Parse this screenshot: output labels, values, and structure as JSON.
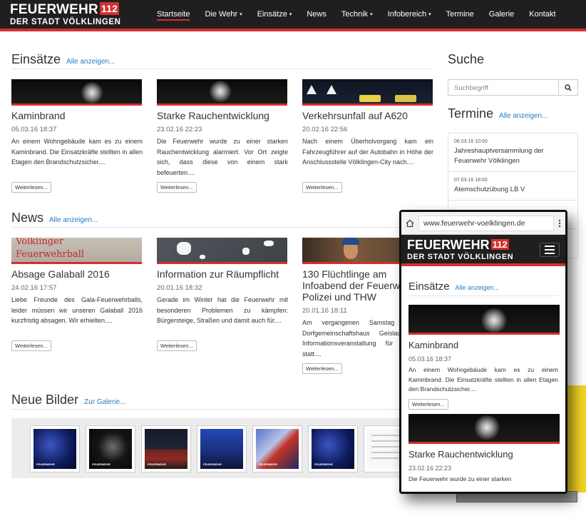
{
  "header": {
    "logo": {
      "line1": "FEUERWEHR",
      "number": "112",
      "line2": "DER STADT VÖLKLINGEN"
    },
    "nav": [
      {
        "label": "Startseite",
        "caret": ""
      },
      {
        "label": "Die Wehr",
        "caret": "▾"
      },
      {
        "label": "Einsätze",
        "caret": "▾"
      },
      {
        "label": "News",
        "caret": ""
      },
      {
        "label": "Technik",
        "caret": "▾"
      },
      {
        "label": "Infobereich",
        "caret": "▾"
      },
      {
        "label": "Termine",
        "caret": ""
      },
      {
        "label": "Galerie",
        "caret": ""
      },
      {
        "label": "Kontakt",
        "caret": ""
      }
    ],
    "active_nav": "Startseite"
  },
  "einsaetze": {
    "title": "Einsätze",
    "link": "Alle anzeigen...",
    "items": [
      {
        "title": "Kaminbrand",
        "date": "05.03.16 18:37",
        "text": "An einem Wohngebäude kam es zu einem Kaminbrand. Die Einsatzkräfte stellten in allen Etagen den Brandschutzsicher....",
        "button": "Weiterlesen..."
      },
      {
        "title": "Starke Rauchentwicklung",
        "date": "23.02.16 22:23",
        "text": "Die Feuerwehr wurde zu einer starken Rauchentwicklung alarmiert. Vor Ort zeigte sich, dass diese von einem stark befeuerten....",
        "button": "Weiterlesen..."
      },
      {
        "title": "Verkehrsunfall auf A620",
        "date": "20.02.16 22:56",
        "text": "Nach einem Überholvorgang kam ein Fahrzeugführer auf der Autobahn in Höhe der Anschlussstelle Völklingen-City nach....",
        "button": "Weiterlesen..."
      }
    ]
  },
  "news": {
    "title": "News",
    "link": "Alle anzeigen...",
    "items": [
      {
        "title": "Absage Galaball 2016",
        "date": "24.02.16 17:57",
        "text": "Liebe Freunde des Gala-Feuerwehrballs, leider müssen wir unseren Galaball 2016 kurzfristig absagen. Wir erhielten....",
        "button": "Weiterlesen...",
        "image_text_1": "Völklinger",
        "image_text_2": "Feuerwehrball"
      },
      {
        "title": "Information zur Räumpflicht",
        "date": "20.01.16 18:32",
        "text": "Gerade im Winter hat die Feuerwehr mit besonderen Problemen zu kämpfen: Bürgersteige, Straßen und damit auch für....",
        "button": "Weiterlesen..."
      },
      {
        "title": "130 Flüchtlinge am Infoabend der Feuerwehr, Polizei und THW",
        "date": "20.01.16 18:11",
        "text": "Am vergangenen Samstag fand im Dorfgemeinschaftshaus Geislautern eine Informationsveranstaltung für Flüchtlinge statt....",
        "button": "Weiterlesen..."
      }
    ]
  },
  "gallery": {
    "title": "Neue Bilder",
    "link": "Zur Galerie...",
    "thumbs": [
      "blue-night-ladder",
      "dark-fire",
      "fire-truck",
      "ladder-sky",
      "firefighter-close",
      "night-ladder",
      "document"
    ]
  },
  "sidebar": {
    "search_title": "Suche",
    "search_placeholder": "Suchbegriff",
    "termine_title": "Termine",
    "termine_link": "Alle anzeigen...",
    "termine": [
      {
        "date": "06.03.16 10:00",
        "title": "Jahreshauptversammlung der Feuerwehr Völklingen"
      },
      {
        "date": "07.03.16 18:00",
        "title": "Atemschutzübung LB V"
      }
    ]
  },
  "phone": {
    "url": "www.feuerwehr-voelklingen.de",
    "section_title": "Einsätze",
    "section_link": "Alle anzeigen...",
    "items": [
      {
        "title": "Kaminbrand",
        "date": "05.03.16 18:37",
        "text": "An einem Wohngebäude kam es zu einem Kaminbrand. Die Einsatzkräfte stellten in allen Etagen den Brandschutzsicher....",
        "button": "Weiterlesen..."
      },
      {
        "title": "Starke Rauchentwicklung",
        "date": "23.02.16 22:23",
        "text": "Die Feuerwehr wurde zu einer starken"
      }
    ]
  },
  "colors": {
    "accent": "#d32f2f",
    "header_bg": "#1f1f1f",
    "link": "#2a7bbf"
  }
}
